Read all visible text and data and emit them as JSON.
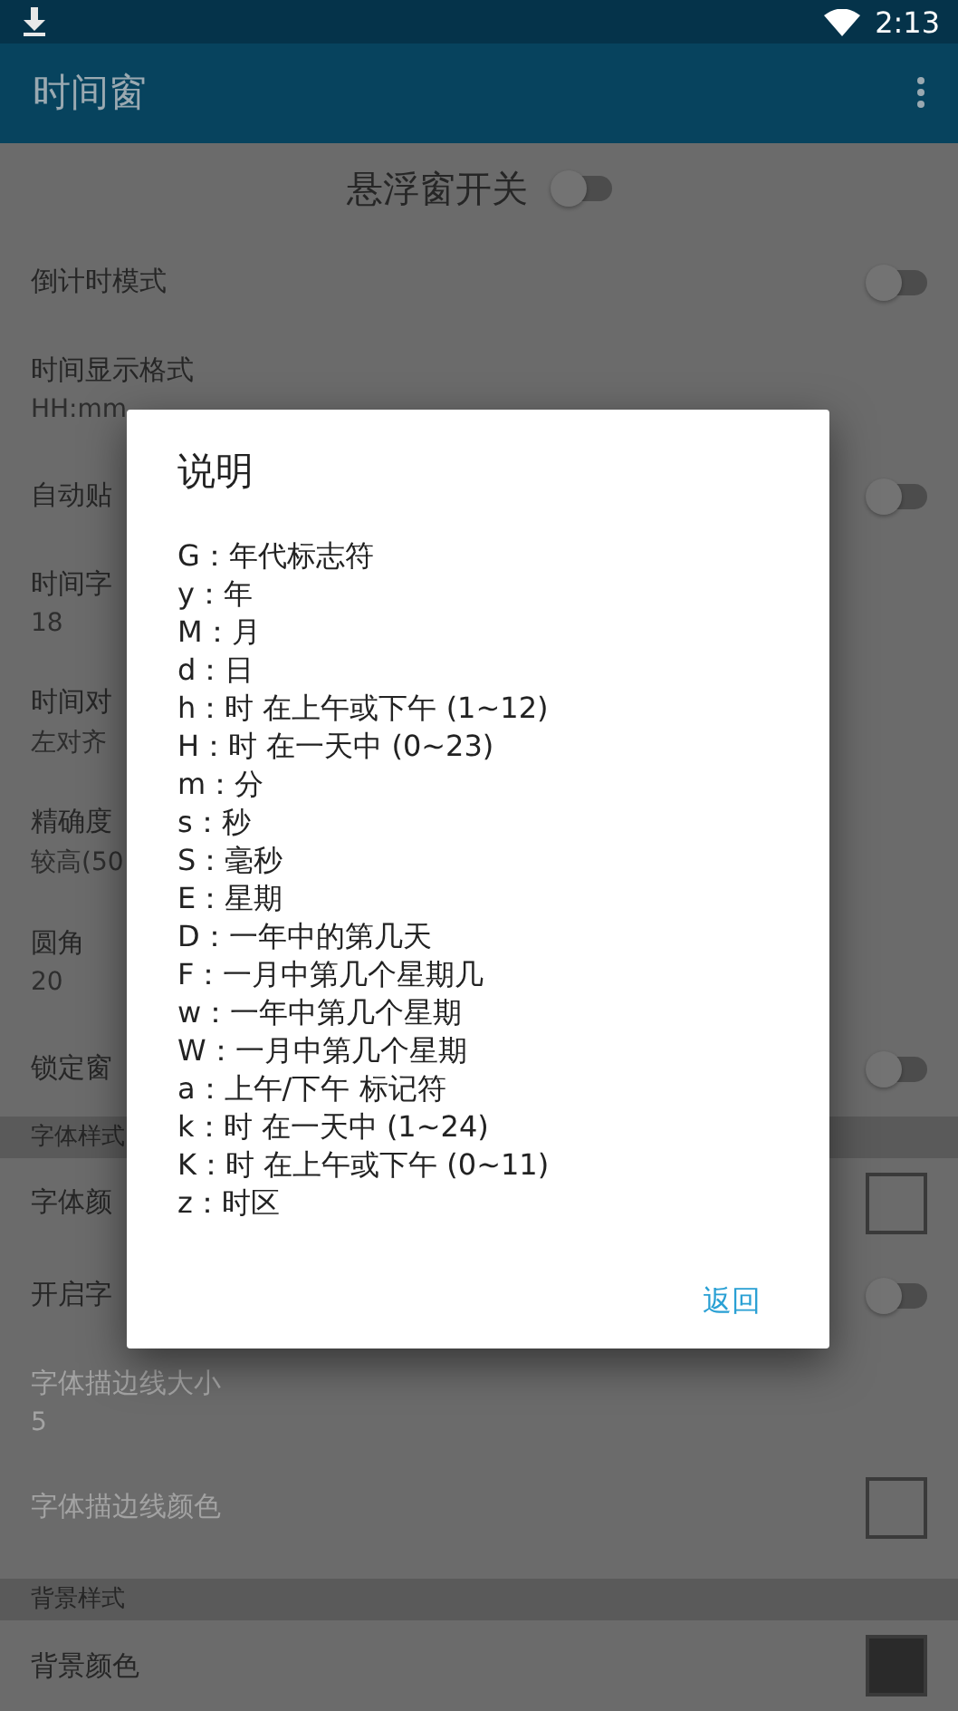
{
  "status_bar": {
    "time": "2:13"
  },
  "app_bar": {
    "title": "时间窗"
  },
  "master_switch": {
    "label": "悬浮窗开关",
    "on": false
  },
  "settings": [
    {
      "kind": "toggle",
      "label": "倒计时模式",
      "on": false,
      "disabled": false
    },
    {
      "kind": "value",
      "label": "时间显示格式",
      "value": "HH:mm",
      "disabled": false
    },
    {
      "kind": "toggle",
      "label": "自动贴",
      "on": false,
      "disabled": false
    },
    {
      "kind": "value",
      "label": "时间字",
      "value": "18",
      "disabled": false
    },
    {
      "kind": "value",
      "label": "时间对",
      "value": "左对齐",
      "disabled": false
    },
    {
      "kind": "value",
      "label": "精确度",
      "value": "较高(50",
      "disabled": false
    },
    {
      "kind": "value",
      "label": "圆角",
      "value": "20",
      "disabled": false
    },
    {
      "kind": "toggle",
      "label": "锁定窗",
      "on": false,
      "disabled": false
    },
    {
      "kind": "header",
      "label": "字体样式",
      "disabled": false
    },
    {
      "kind": "swatch",
      "label": "字体颜",
      "color": "#6b6b6b",
      "disabled": false
    },
    {
      "kind": "toggle",
      "label": "开启字",
      "on": false,
      "disabled": false
    },
    {
      "kind": "value",
      "label": "字体描边线大小",
      "value": "5",
      "disabled": true
    },
    {
      "kind": "swatch",
      "label": "字体描边线颜色",
      "color": "#6b6b6b",
      "disabled": true
    },
    {
      "kind": "header",
      "label": "背景样式",
      "disabled": false
    },
    {
      "kind": "swatch",
      "label": "背景颜色",
      "color": "#2a2a2a",
      "disabled": false
    }
  ],
  "dialog": {
    "title": "说明",
    "lines": [
      "G：年代标志符",
      "y：年",
      "M：月",
      "d：日",
      "h：时 在上午或下午 (1~12)",
      "H：时 在一天中 (0~23)",
      "m：分",
      "s：秒",
      "S：毫秒",
      "E：星期",
      "D：一年中的第几天",
      "F：一月中第几个星期几",
      "w：一年中第几个星期",
      "W：一月中第几个星期",
      "a：上午/下午 标记符",
      "k：时 在一天中 (1~24)",
      "K：时 在上午或下午 (0~11)",
      "z：时区"
    ],
    "button": "返回"
  }
}
